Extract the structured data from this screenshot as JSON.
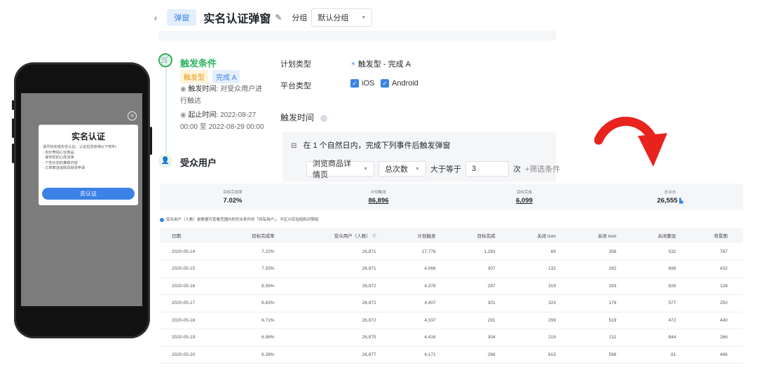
{
  "header": {
    "back_icon": "‹",
    "tag": "弹窗",
    "title": "实名认证弹窗",
    "group_label": "分组",
    "group_value": "默认分组"
  },
  "timeline": {
    "step1": {
      "title": "触发条件",
      "tags": [
        "触发型",
        "完成 A"
      ],
      "trigger_time_label": "触发时间:",
      "trigger_time_value": "对受众用户进行触达",
      "period_label": "起止时间:",
      "period_value": "2022-08-27 00:00 至 2022-08-29 00:00"
    },
    "step2": {
      "title": "受众用户"
    }
  },
  "config": {
    "plan_type_label": "计划类型",
    "plan_type_value": "触发型 - 完成 A",
    "platform_label": "平台类型",
    "platforms": [
      "iOS",
      "Android"
    ],
    "trigger_time_label": "触发时间",
    "condition_text": "在 1 个自然日内，完成下列事件后触发弹窗",
    "event_select": "浏览商品详情页",
    "metric_select": "总次数",
    "operator": "大于等于",
    "count_value": "3",
    "count_unit": "次",
    "filter_button": "筛选条件"
  },
  "phone_modal": {
    "title": "实名认证",
    "desc": "请尽快完成实名认证，认证后您获得以下权利：",
    "items": [
      "· 出价竞拍心仪商品",
      "· 保存您的心愿清单",
      "· 个性化您的推荐内容",
      "· 订单寄送追踪及缺货申请"
    ],
    "button": "去认证"
  },
  "stats": [
    {
      "label": "目标完成率",
      "value": "7.02%"
    },
    {
      "label": "计划触发",
      "value": "86,896"
    },
    {
      "label": "目标完成",
      "value": "6,099"
    },
    {
      "label": "总点击",
      "value": "26,555"
    }
  ],
  "note": "受众用户（人数）是数据可查看范围内的符合条件的「所有用户」，不区分实验组和对照组",
  "table": {
    "headers": [
      "日期",
      "目标完成率",
      "受众用户（人数）",
      "计划触发",
      "目标完成",
      "关闭 icon",
      "关闭 icon",
      "关闭蒙层",
      "背景图"
    ],
    "rows": [
      [
        "2020-05-14",
        "7.22%",
        "26,871",
        "17,776",
        "1,283",
        "69",
        "358",
        "532",
        "787"
      ],
      [
        "2020-05-15",
        "7.55%",
        "26,871",
        "4,066",
        "307",
        "132",
        "292",
        "698",
        "432"
      ],
      [
        "2020-05-16",
        "6.56%",
        "26,872",
        "4,378",
        "287",
        "319",
        "193",
        "826",
        "128"
      ],
      [
        "2020-05-17",
        "6.83%",
        "26,872",
        "4,407",
        "301",
        "323",
        "176",
        "577",
        "250"
      ],
      [
        "2020-05-18",
        "6.71%",
        "26,872",
        "4,337",
        "291",
        "299",
        "519",
        "472",
        "440"
      ],
      [
        "2020-05-19",
        "6.88%",
        "26,875",
        "4,416",
        "304",
        "216",
        "211",
        "844",
        "266"
      ],
      [
        "2020-05-20",
        "6.38%",
        "26,877",
        "4,171",
        "266",
        "615",
        "596",
        "81",
        "496"
      ]
    ]
  },
  "colors": {
    "accent": "#3b82e6",
    "success": "#2fb35e",
    "arrow": "#e8231e"
  }
}
